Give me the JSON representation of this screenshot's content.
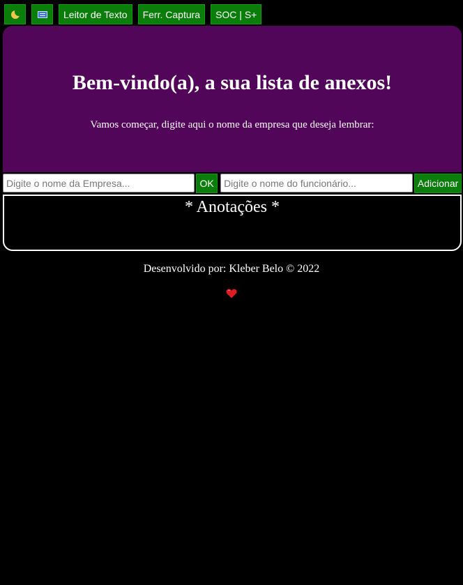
{
  "toolbar": {
    "theme_icon": "moon-icon",
    "keyboard_icon": "keyboard-icon",
    "reader_label": "Leitor de Texto",
    "capture_label": "Ferr. Captura",
    "soc_label": "SOC | S+"
  },
  "hero": {
    "title": "Bem-vindo(a), a sua lista de anexos!",
    "subtitle": "Vamos começar, digite aqui o nome da empresa que deseja lembrar:"
  },
  "form": {
    "company_placeholder": "Digite o nome da Empresa...",
    "company_value": "",
    "ok_label": "OK",
    "employee_placeholder": "Digite o nome do funcionário...",
    "employee_value": "",
    "add_label": "Adicionar"
  },
  "notes": {
    "title": "* Anotações *"
  },
  "footer": {
    "credit": "Desenvolvido por: Kleber Belo © 2022",
    "heart_icon": "heart-icon"
  },
  "colors": {
    "background": "#000000",
    "hero": "#520659",
    "button": "#0a7d0a",
    "heart": "#e01b24"
  }
}
